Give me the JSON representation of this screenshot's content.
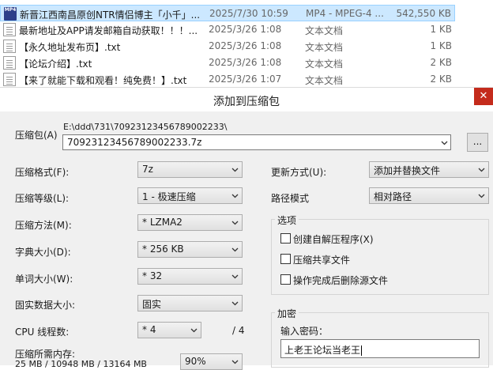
{
  "files": [
    {
      "name": "新晋江西南昌原创NTR情侣博主「小千」...",
      "date": "2025/7/30 10:59",
      "type": "MP4 - MPEG-4 ...",
      "size": "542,550 KB",
      "icon": "mp4-file-icon",
      "icon_text": "MP4"
    },
    {
      "name": "最新地址及APP请发邮箱自动获取！！！...",
      "date": "2025/3/26 1:08",
      "type": "文本文档",
      "size": "1 KB",
      "icon": "text-file-icon"
    },
    {
      "name": "【永久地址发布页】.txt",
      "date": "2025/3/26 1:08",
      "type": "文本文档",
      "size": "1 KB",
      "icon": "text-file-icon"
    },
    {
      "name": "【论坛介绍】.txt",
      "date": "2025/3/26 1:08",
      "type": "文本文档",
      "size": "2 KB",
      "icon": "text-file-icon"
    },
    {
      "name": "【来了就能下载和观看！纯免费！】.txt",
      "date": "2025/3/26 1:07",
      "type": "文本文档",
      "size": "2 KB",
      "icon": "text-file-icon"
    }
  ],
  "dialog": {
    "title": "添加到压缩包",
    "close": "✕",
    "archive_label": "压缩包(A)",
    "archive_path": "E:\\ddd\\731\\70923123456789002233\\",
    "archive_name": "70923123456789002233.7z",
    "browse": "...",
    "format_label": "压缩格式(F):",
    "format_value": "7z",
    "level_label": "压缩等级(L):",
    "level_value": "1 - 极速压缩",
    "method_label": "压缩方法(M):",
    "method_value": "* LZMA2",
    "dict_label": "字典大小(D):",
    "dict_value": "* 256 KB",
    "word_label": "单词大小(W):",
    "word_value": "* 32",
    "solid_label": "固实数据大小:",
    "solid_value": "固实",
    "threads_label": "CPU 线程数:",
    "threads_value": "* 4",
    "threads_max": "/ 4",
    "memory_label": "压缩所需内存:",
    "memory_detail": "25 MB / 10948 MB / 13164 MB",
    "memory_pct": "90%",
    "update_label": "更新方式(U):",
    "update_value": "添加并替换文件",
    "pathmode_label": "路径模式",
    "pathmode_value": "相对路径",
    "options_title": "选项",
    "opt_sfx": "创建自解压程序(X)",
    "opt_shared": "压缩共享文件",
    "opt_delete": "操作完成后删除源文件",
    "enc_title": "加密",
    "pwd_label": "输入密码：",
    "pwd_value": "上老王论坛当老王"
  }
}
